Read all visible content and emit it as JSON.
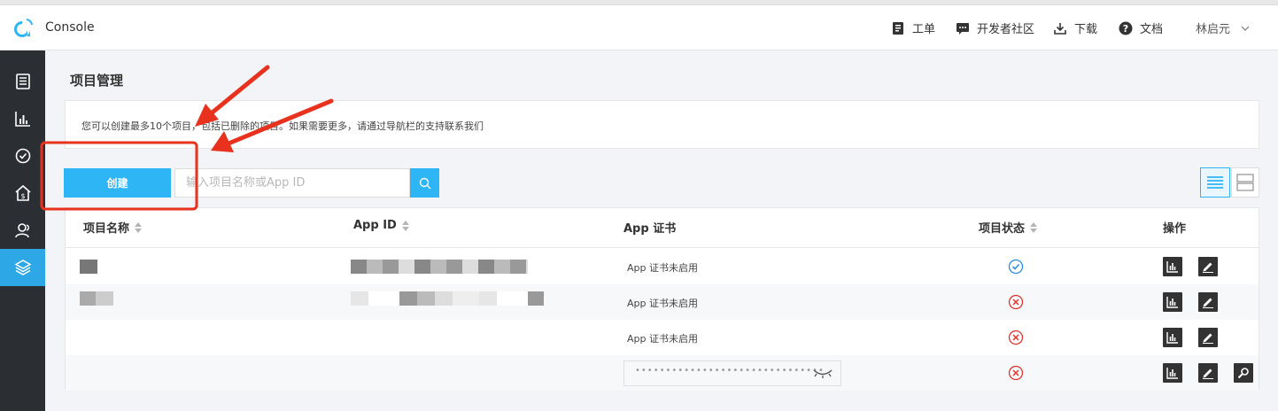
{
  "header": {
    "brand": "Console",
    "nav": [
      {
        "icon": "ticket-icon",
        "label": "工单"
      },
      {
        "icon": "community-icon",
        "label": "开发者社区"
      },
      {
        "icon": "download-icon",
        "label": "下载"
      },
      {
        "icon": "help-icon",
        "label": "文档"
      }
    ],
    "user": "林启元"
  },
  "sidebar": {
    "items": [
      {
        "icon": "document-icon"
      },
      {
        "icon": "bar-chart-icon"
      },
      {
        "icon": "target-icon"
      },
      {
        "icon": "home-dollar-icon"
      },
      {
        "icon": "user-icon"
      },
      {
        "icon": "layers-icon",
        "active": true
      }
    ]
  },
  "page": {
    "title": "项目管理",
    "notice": "您可以创建最多10个项目，包括已删除的项目。如果需要更多，请通过导航栏的支持联系我们"
  },
  "toolbar": {
    "create_label": "创建",
    "search_placeholder": "输入项目名称或App ID"
  },
  "table": {
    "columns": {
      "name": "项目名称",
      "app_id": "App ID",
      "cert": "App 证书",
      "status": "项目状态",
      "actions": "操作"
    },
    "rows": [
      {
        "cert": "App 证书未启用",
        "status": "enabled"
      },
      {
        "cert": "App 证书未启用",
        "status": "disabled"
      },
      {
        "cert": "App 证书未启用",
        "status": "disabled"
      },
      {
        "cert_mask": "•••••••••••••••••••••••••••••••",
        "status": "disabled"
      }
    ]
  },
  "colors": {
    "accent": "#2db5f5",
    "sidebar": "#2b2e33",
    "annotation": "#e8321e",
    "ok": "#2a8de0",
    "error": "#e0342d"
  }
}
